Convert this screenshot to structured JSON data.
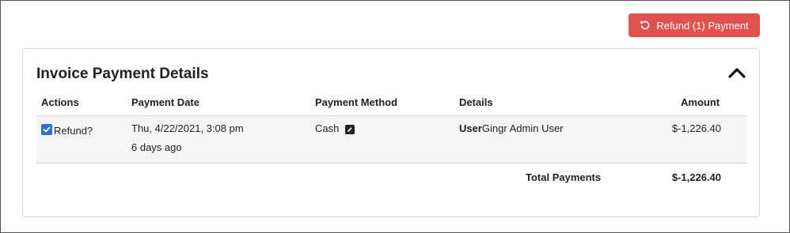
{
  "toolbar": {
    "refund_button_label": "Refund (1) Payment",
    "refund_icon": "undo-icon",
    "refund_color": "#e0524d"
  },
  "card": {
    "title": "Invoice Payment Details",
    "collapse_icon": "chevron-up-icon"
  },
  "table": {
    "columns": [
      "Actions",
      "Payment Date",
      "Payment Method",
      "Details",
      "Amount"
    ],
    "rows": [
      {
        "refund_checked": true,
        "refund_label": "Refund?",
        "date": "Thu, 4/22/2021, 3:08 pm",
        "relative": "6 days ago",
        "method": "Cash",
        "method_icon": "edit-icon",
        "detail_key": "User",
        "detail_value": "Gingr Admin User",
        "amount": "$-1,226.40"
      }
    ],
    "total_label": "Total Payments",
    "total_amount": "$-1,226.40"
  }
}
